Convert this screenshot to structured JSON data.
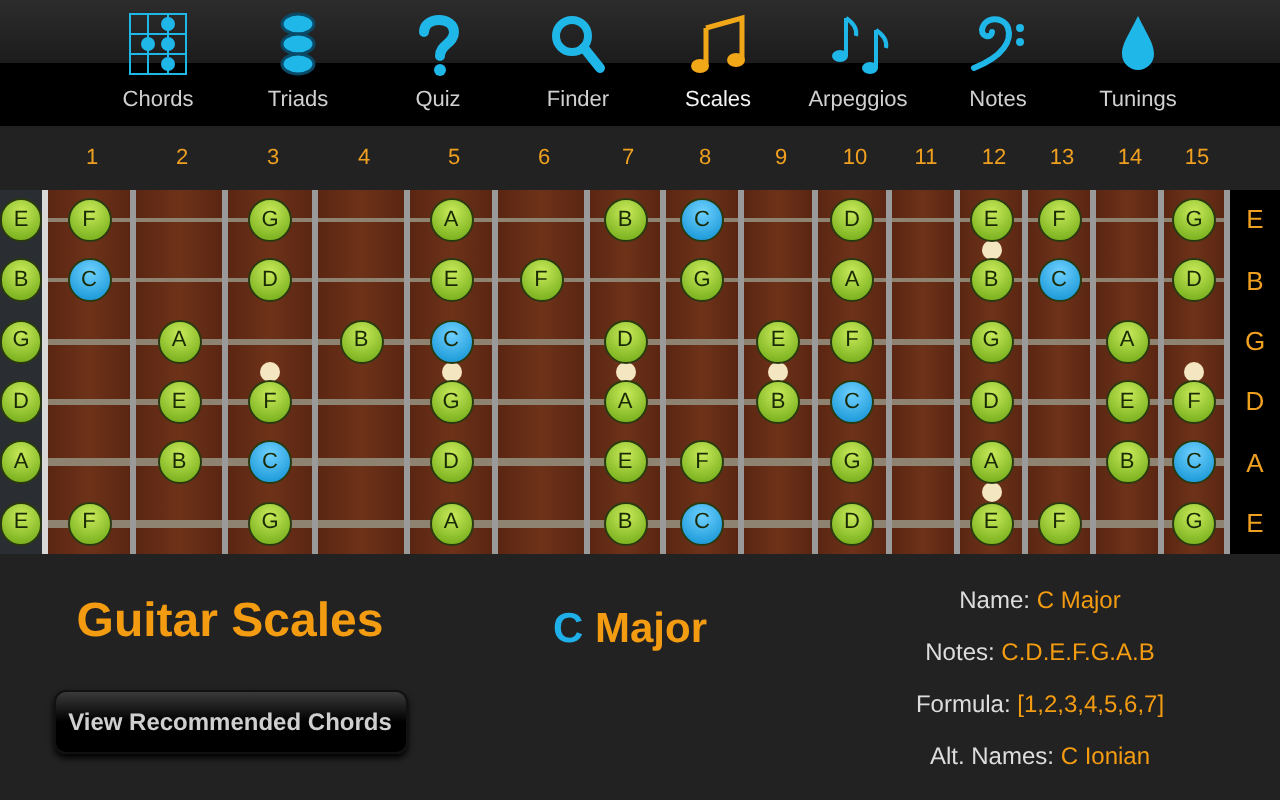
{
  "nav": [
    {
      "label": "Chords",
      "selected": false
    },
    {
      "label": "Triads",
      "selected": false
    },
    {
      "label": "Quiz",
      "selected": false
    },
    {
      "label": "Finder",
      "selected": false
    },
    {
      "label": "Scales",
      "selected": true
    },
    {
      "label": "Arpeggios",
      "selected": false
    },
    {
      "label": "Notes",
      "selected": false
    },
    {
      "label": "Tunings",
      "selected": false
    }
  ],
  "fret_numbers": [
    "1",
    "2",
    "3",
    "4",
    "5",
    "6",
    "7",
    "8",
    "9",
    "10",
    "11",
    "12",
    "13",
    "14",
    "15"
  ],
  "strings": [
    {
      "label": "E",
      "notes": [
        {
          "kind": "note",
          "note": "E",
          "root": false
        },
        {
          "kind": "note",
          "note": "F",
          "root": false
        },
        {
          "kind": "empty"
        },
        {
          "kind": "note",
          "note": "G",
          "root": false
        },
        {
          "kind": "empty"
        },
        {
          "kind": "note",
          "note": "A",
          "root": false
        },
        {
          "kind": "empty"
        },
        {
          "kind": "note",
          "note": "B",
          "root": false
        },
        {
          "kind": "note",
          "note": "C",
          "root": true
        },
        {
          "kind": "empty"
        },
        {
          "kind": "note",
          "note": "D",
          "root": false
        },
        {
          "kind": "empty"
        },
        {
          "kind": "note",
          "note": "E",
          "root": false
        },
        {
          "kind": "note",
          "note": "F",
          "root": false
        },
        {
          "kind": "empty"
        },
        {
          "kind": "note",
          "note": "G",
          "root": false
        }
      ]
    },
    {
      "label": "B",
      "notes": [
        {
          "kind": "note",
          "note": "B",
          "root": false
        },
        {
          "kind": "note",
          "note": "C",
          "root": true
        },
        {
          "kind": "empty"
        },
        {
          "kind": "note",
          "note": "D",
          "root": false
        },
        {
          "kind": "empty"
        },
        {
          "kind": "note",
          "note": "E",
          "root": false
        },
        {
          "kind": "note",
          "note": "F",
          "root": false
        },
        {
          "kind": "empty"
        },
        {
          "kind": "note",
          "note": "G",
          "root": false
        },
        {
          "kind": "empty"
        },
        {
          "kind": "note",
          "note": "A",
          "root": false
        },
        {
          "kind": "empty"
        },
        {
          "kind": "note",
          "note": "B",
          "root": false
        },
        {
          "kind": "note",
          "note": "C",
          "root": true
        },
        {
          "kind": "empty"
        },
        {
          "kind": "note",
          "note": "D",
          "root": false
        }
      ]
    },
    {
      "label": "G",
      "notes": [
        {
          "kind": "note",
          "note": "G",
          "root": false
        },
        {
          "kind": "empty"
        },
        {
          "kind": "note",
          "note": "A",
          "root": false
        },
        {
          "kind": "empty"
        },
        {
          "kind": "note",
          "note": "B",
          "root": false
        },
        {
          "kind": "note",
          "note": "C",
          "root": true
        },
        {
          "kind": "empty"
        },
        {
          "kind": "note",
          "note": "D",
          "root": false
        },
        {
          "kind": "empty"
        },
        {
          "kind": "note",
          "note": "E",
          "root": false
        },
        {
          "kind": "note",
          "note": "F",
          "root": false
        },
        {
          "kind": "empty"
        },
        {
          "kind": "note",
          "note": "G",
          "root": false
        },
        {
          "kind": "empty"
        },
        {
          "kind": "note",
          "note": "A",
          "root": false
        },
        {
          "kind": "empty"
        }
      ]
    },
    {
      "label": "D",
      "notes": [
        {
          "kind": "note",
          "note": "D",
          "root": false
        },
        {
          "kind": "empty"
        },
        {
          "kind": "note",
          "note": "E",
          "root": false
        },
        {
          "kind": "note",
          "note": "F",
          "root": false
        },
        {
          "kind": "empty"
        },
        {
          "kind": "note",
          "note": "G",
          "root": false
        },
        {
          "kind": "empty"
        },
        {
          "kind": "note",
          "note": "A",
          "root": false
        },
        {
          "kind": "empty"
        },
        {
          "kind": "note",
          "note": "B",
          "root": false
        },
        {
          "kind": "note",
          "note": "C",
          "root": true
        },
        {
          "kind": "empty"
        },
        {
          "kind": "note",
          "note": "D",
          "root": false
        },
        {
          "kind": "empty"
        },
        {
          "kind": "note",
          "note": "E",
          "root": false
        },
        {
          "kind": "note",
          "note": "F",
          "root": false
        }
      ]
    },
    {
      "label": "A",
      "notes": [
        {
          "kind": "note",
          "note": "A",
          "root": false
        },
        {
          "kind": "empty"
        },
        {
          "kind": "note",
          "note": "B",
          "root": false
        },
        {
          "kind": "note",
          "note": "C",
          "root": true
        },
        {
          "kind": "empty"
        },
        {
          "kind": "note",
          "note": "D",
          "root": false
        },
        {
          "kind": "empty"
        },
        {
          "kind": "note",
          "note": "E",
          "root": false
        },
        {
          "kind": "note",
          "note": "F",
          "root": false
        },
        {
          "kind": "empty"
        },
        {
          "kind": "note",
          "note": "G",
          "root": false
        },
        {
          "kind": "empty"
        },
        {
          "kind": "note",
          "note": "A",
          "root": false
        },
        {
          "kind": "empty"
        },
        {
          "kind": "note",
          "note": "B",
          "root": false
        },
        {
          "kind": "note",
          "note": "C",
          "root": true
        }
      ]
    },
    {
      "label": "E",
      "notes": [
        {
          "kind": "note",
          "note": "E",
          "root": false
        },
        {
          "kind": "note",
          "note": "F",
          "root": false
        },
        {
          "kind": "empty"
        },
        {
          "kind": "note",
          "note": "G",
          "root": false
        },
        {
          "kind": "empty"
        },
        {
          "kind": "note",
          "note": "A",
          "root": false
        },
        {
          "kind": "empty"
        },
        {
          "kind": "note",
          "note": "B",
          "root": false
        },
        {
          "kind": "note",
          "note": "C",
          "root": true
        },
        {
          "kind": "empty"
        },
        {
          "kind": "note",
          "note": "D",
          "root": false
        },
        {
          "kind": "empty"
        },
        {
          "kind": "note",
          "note": "E",
          "root": false
        },
        {
          "kind": "note",
          "note": "F",
          "root": false
        },
        {
          "kind": "empty"
        },
        {
          "kind": "note",
          "note": "G",
          "root": false
        }
      ]
    }
  ],
  "page_title": "Guitar Scales",
  "button": "View Recommended Chords",
  "scale_title": {
    "root": "C",
    "quality": "Major"
  },
  "info": [
    {
      "label": "Name:",
      "value": "C Major"
    },
    {
      "label": "Notes:",
      "value": "C.D.E.F.G.A.B"
    },
    {
      "label": "Formula:",
      "value": "[1,2,3,4,5,6,7]"
    },
    {
      "label": "Alt. Names:",
      "value": "C Ionian"
    }
  ]
}
